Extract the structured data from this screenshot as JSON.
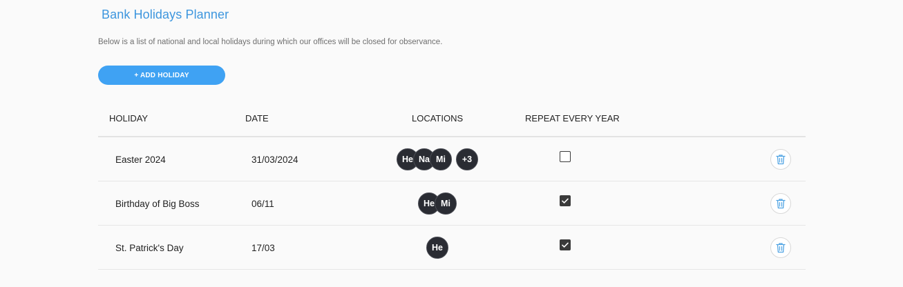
{
  "page": {
    "title": "Bank Holidays Planner",
    "subtitle": "Below is a list of national and local holidays during which our offices will be closed for observance.",
    "add_button_label": "+ ADD HOLIDAY"
  },
  "table": {
    "headers": {
      "holiday": "HOLIDAY",
      "date": "DATE",
      "locations": "LOCATIONS",
      "repeat": "REPEAT EVERY YEAR"
    },
    "rows": [
      {
        "holiday": "Easter 2024",
        "date": "31/03/2024",
        "locations": [
          "He",
          "Na",
          "Mi"
        ],
        "more_locations": "+3",
        "repeat_every_year": false
      },
      {
        "holiday": "Birthday of Big Boss",
        "date": "06/11",
        "locations": [
          "He",
          "Mi"
        ],
        "more_locations": "",
        "repeat_every_year": true
      },
      {
        "holiday": "St. Patrick's Day",
        "date": "17/03",
        "locations": [
          "He"
        ],
        "more_locations": "",
        "repeat_every_year": true
      }
    ]
  },
  "icons": {
    "delete": "trash-icon",
    "checkmark": "checkmark-icon"
  },
  "colors": {
    "accent": "#3fa2f3",
    "title": "#3d96de",
    "avatar_bg": "#2a2c33",
    "delete_icon": "#4fa3e3"
  }
}
